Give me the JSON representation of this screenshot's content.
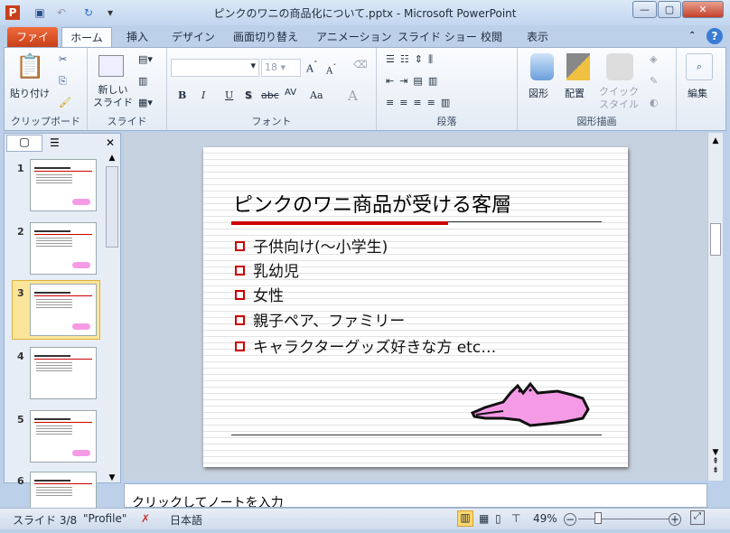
{
  "window": {
    "title": "ピンクのワニの商品化について.pptx - Microsoft PowerPoint"
  },
  "tabs": [
    "ファイル",
    "ホーム",
    "挿入",
    "デザイン",
    "画面切り替え",
    "アニメーション",
    "スライド ショー",
    "校閲",
    "表示"
  ],
  "ribbon": {
    "clipboard": {
      "paste": "貼り付け",
      "label": "クリップボード"
    },
    "slides": {
      "new_slide": "新しい\nスライド",
      "label": "スライド"
    },
    "font": {
      "size": "18",
      "label": "フォント",
      "bold": "B",
      "italic": "I",
      "underline": "U",
      "shadow": "S",
      "strike": "abc",
      "spacing": "AV",
      "case": "Aa",
      "color": "A"
    },
    "paragraph": {
      "label": "段落"
    },
    "drawing": {
      "shapes": "図形",
      "arrange": "配置",
      "quick_styles": "クイック\nスタイル",
      "label": "図形描画"
    },
    "editing": {
      "label": "編集"
    }
  },
  "slides": [
    {
      "num": "1"
    },
    {
      "num": "2"
    },
    {
      "num": "3"
    },
    {
      "num": "4"
    },
    {
      "num": "5"
    },
    {
      "num": "6"
    }
  ],
  "current_slide": {
    "title": "ピンクのワニ商品が受ける客層",
    "bullets": [
      "子供向け(〜小学生)",
      "乳幼児",
      "女性",
      "親子ペア、ファミリー",
      "キャラクターグッズ好きな方 etc…"
    ]
  },
  "notes": {
    "placeholder": "クリックしてノートを入力"
  },
  "status": {
    "slide": "スライド 3/8",
    "theme": "\"Profile\"",
    "language": "日本語",
    "zoom": "49%",
    "zoom_percent": 49
  },
  "colors": {
    "accent_red": "#cc0000",
    "croc_pink": "#f59be6",
    "file_tab": "#d9532a"
  }
}
